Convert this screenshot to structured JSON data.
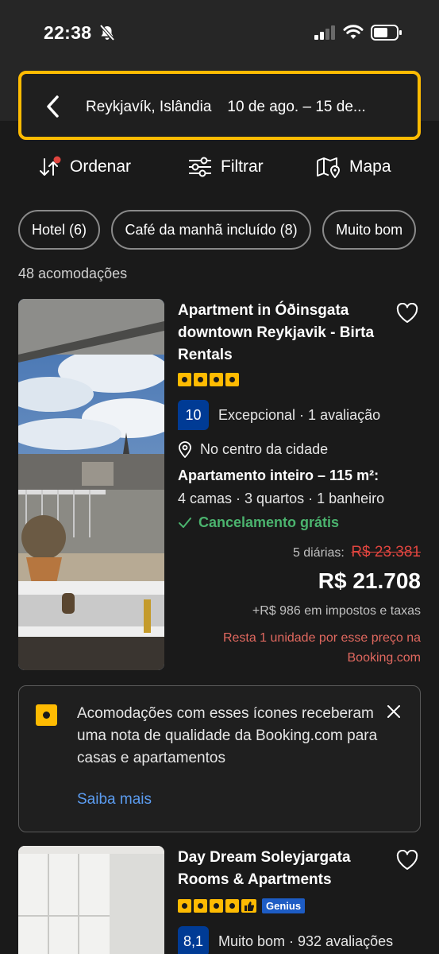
{
  "status_bar": {
    "time": "22:38"
  },
  "search": {
    "destination": "Reykjavík, Islândia",
    "dates": "10 de ago.  –  15 de..."
  },
  "toolbar": {
    "sort_label": "Ordenar",
    "filter_label": "Filtrar",
    "map_label": "Mapa"
  },
  "filters": [
    "Hotel (6)",
    "Café da manhã incluído (8)",
    "Muito bom"
  ],
  "results_count": "48 acomodações",
  "listings": [
    {
      "title": "Apartment in Óðinsgata downtown Reykjavik - Birta Rentals",
      "stars": 4,
      "score": "10",
      "rating_text": "Excepcional · 1 avaliação",
      "location": "No centro da cidade",
      "unit_type": "Apartamento inteiro – 115 m²:",
      "beds": "4 camas · 3 quartos · 1 banheiro",
      "cancellation": "Cancelamento grátis",
      "nights_label": "5 diárias:",
      "old_price": "R$ 23.381",
      "price": "R$ 21.708",
      "taxes": "+R$ 986 em impostos e taxas",
      "scarcity": "Resta 1 unidade por esse preço na Booking.com"
    },
    {
      "title": "Day Dream Soleyjargata Rooms & Apartments",
      "stars": 4,
      "badge": "Genius",
      "score": "8,1",
      "rating_text": "Muito bom · 932 avaliações"
    }
  ],
  "notice": {
    "text": "Acomodações com esses ícones receberam uma nota de qualidade da Booking.com para casas e apartamentos",
    "link": "Saiba mais"
  },
  "colors": {
    "accent": "#febb02",
    "score_bg": "#003b95",
    "link": "#5b9cf0",
    "green": "#4bb36e",
    "red": "#e0453f"
  }
}
